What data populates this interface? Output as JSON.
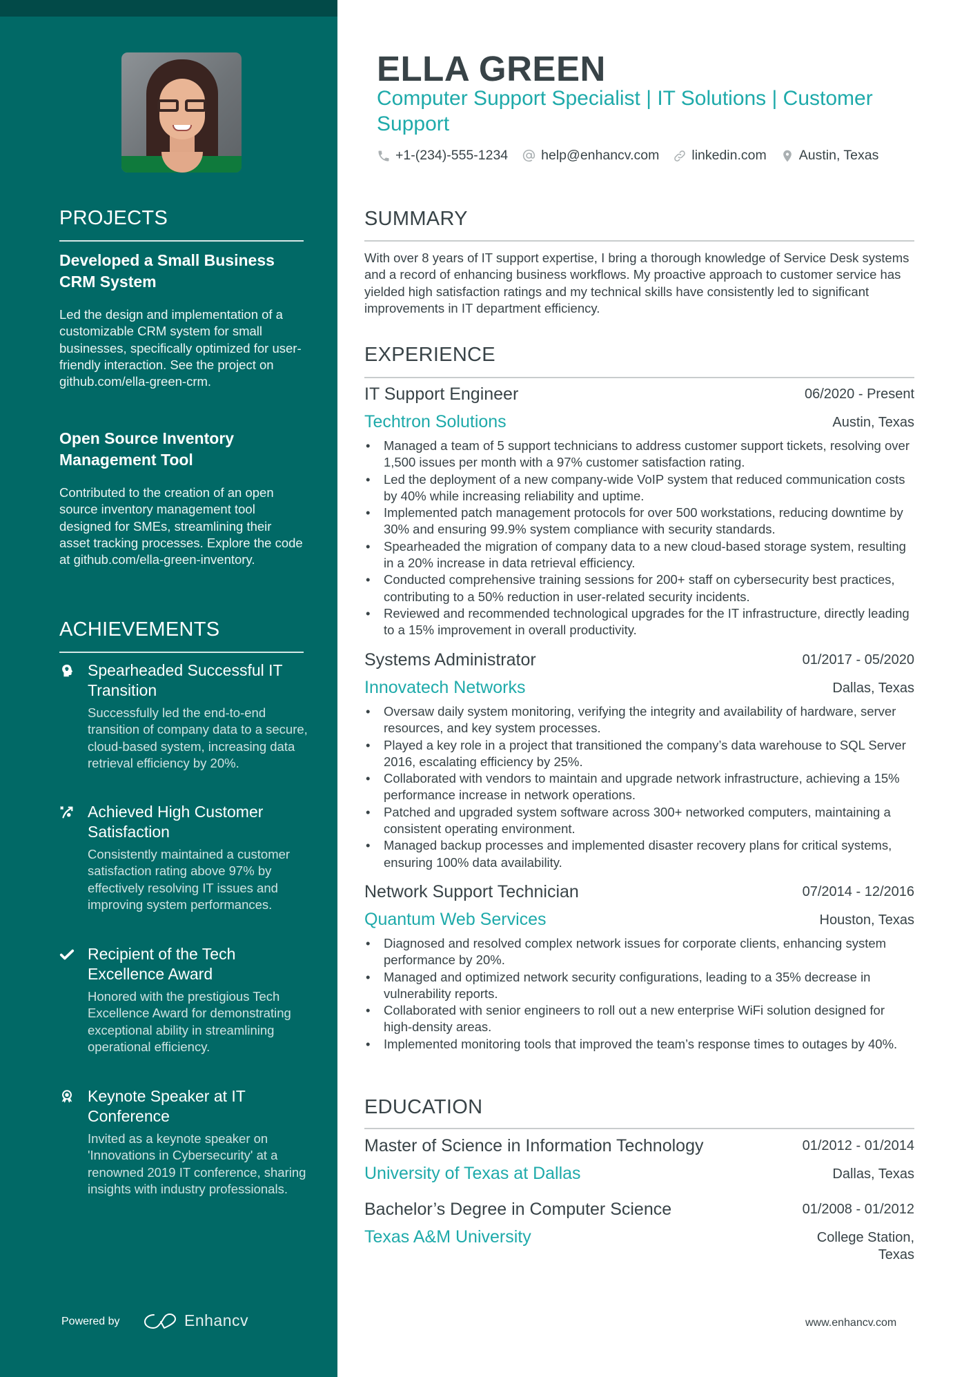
{
  "profile": {
    "name": "ELLA GREEN",
    "headline": "Computer Support Specialist | IT Solutions | Customer Support",
    "photo_alt": "Profile photo of Ella Green",
    "contacts": [
      {
        "icon": "phone-icon",
        "text": "+1-(234)-555-1234"
      },
      {
        "icon": "at-sign-icon",
        "text": "help@enhancv.com"
      },
      {
        "icon": "link-icon",
        "text": "linkedin.com"
      },
      {
        "icon": "location-pin-icon",
        "text": "Austin, Texas"
      }
    ]
  },
  "sidebar": {
    "projects_title": "PROJECTS",
    "projects": [
      {
        "title": "Developed a Small Business CRM System",
        "description": "Led the design and implementation of a customizable CRM system for small businesses, specifically optimized for user-friendly interaction. See the project on github.com/ella-green-crm."
      },
      {
        "title": "Open Source Inventory Management Tool",
        "description": "Contributed to the creation of an open source inventory management tool designed for SMEs, streamlining their asset tracking processes. Explore the code at github.com/ella-green-inventory."
      }
    ],
    "achievements_title": "ACHIEVEMENTS",
    "achievements": [
      {
        "icon": "brain-head-icon",
        "title": "Spearheaded Successful IT Transition",
        "description": "Successfully led the end-to-end transition of company data to a secure, cloud-based system, increasing data retrieval efficiency by 20%."
      },
      {
        "icon": "strategy-arrow-icon",
        "title": "Achieved High Customer Satisfaction",
        "description": "Consistently maintained a customer satisfaction rating above 97% by effectively resolving IT issues and improving system performances."
      },
      {
        "icon": "checkmark-icon",
        "title": "Recipient of the Tech Excellence Award",
        "description": "Honored with the prestigious Tech Excellence Award for demonstrating exceptional ability in streamlining operational efficiency."
      },
      {
        "icon": "award-ribbon-icon",
        "title": "Keynote Speaker at IT Conference",
        "description": "Invited as a keynote speaker on 'Innovations in Cybersecurity' at a renowned 2019 IT conference, sharing insights with industry professionals."
      }
    ],
    "powered_by": "Powered by",
    "brand": "Enhancv"
  },
  "summary": {
    "title": "SUMMARY",
    "text": "With over 8 years of IT support expertise, I bring a thorough knowledge of Service Desk systems and a record of enhancing business workflows. My proactive approach to customer service has yielded high satisfaction ratings and my technical skills have consistently led to significant improvements in IT department efficiency."
  },
  "experience": {
    "title": "EXPERIENCE",
    "jobs": [
      {
        "title": "IT Support Engineer",
        "dates": "06/2020 - Present",
        "company": "Techtron Solutions",
        "location": "Austin, Texas",
        "bullets": [
          "Managed a team of 5 support technicians to address customer support tickets, resolving over 1,500 issues per month with a 97% customer satisfaction rating.",
          "Led the deployment of a new company-wide VoIP system that reduced communication costs by 40% while increasing reliability and uptime.",
          "Implemented patch management protocols for over 500 workstations, reducing downtime by 30% and ensuring 99.9% system compliance with security standards.",
          "Spearheaded the migration of company data to a new cloud-based storage system, resulting in a 20% increase in data retrieval efficiency.",
          "Conducted comprehensive training sessions for 200+ staff on cybersecurity best practices, contributing to a 50% reduction in user-related security incidents.",
          "Reviewed and recommended technological upgrades for the IT infrastructure, directly leading to a 15% improvement in overall productivity."
        ]
      },
      {
        "title": "Systems Administrator",
        "dates": "01/2017 - 05/2020",
        "company": "Innovatech Networks",
        "location": "Dallas, Texas",
        "bullets": [
          "Oversaw daily system monitoring, verifying the integrity and availability of hardware, server resources, and key system processes.",
          "Played a key role in a project that transitioned the company’s data warehouse to SQL Server 2016, escalating efficiency by 25%.",
          "Collaborated with vendors to maintain and upgrade network infrastructure, achieving a 15% performance increase in network operations.",
          "Patched and upgraded system software across 300+ networked computers, maintaining a consistent operating environment.",
          "Managed backup processes and implemented disaster recovery plans for critical systems, ensuring 100% data availability."
        ]
      },
      {
        "title": "Network Support Technician",
        "dates": "07/2014 - 12/2016",
        "company": "Quantum Web Services",
        "location": "Houston, Texas",
        "bullets": [
          "Diagnosed and resolved complex network issues for corporate clients, enhancing system performance by 20%.",
          "Managed and optimized network security configurations, leading to a 35% decrease in vulnerability reports.",
          "Collaborated with senior engineers to roll out a new enterprise WiFi solution designed for high-density areas.",
          "Implemented monitoring tools that improved the team’s response times to outages by 40%."
        ]
      }
    ]
  },
  "education": {
    "title": "EDUCATION",
    "items": [
      {
        "degree": "Master of Science in Information Technology",
        "dates": "01/2012 - 01/2014",
        "school": "University of Texas at Dallas",
        "location": "Dallas, Texas"
      },
      {
        "degree": "Bachelor’s Degree in Computer Science",
        "dates": "01/2008 - 01/2012",
        "school": "Texas A&M University",
        "location": "College Station, Texas"
      }
    ]
  },
  "footer": {
    "url": "www.enhancv.com"
  },
  "colors": {
    "sidebar_bg": "#016966",
    "sidebar_top_strip": "#024a48",
    "accent_teal": "#1eaaaa",
    "text_dark": "#384347"
  }
}
